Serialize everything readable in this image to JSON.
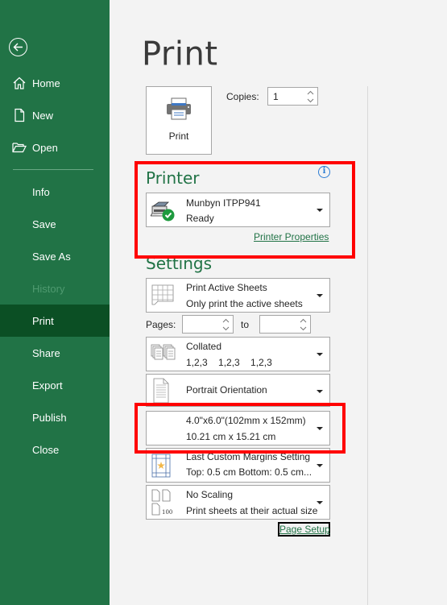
{
  "sidebar": {
    "back_icon": "back-arrow-circle-icon",
    "items": [
      {
        "label": "Home",
        "icon": "home-icon",
        "state": "normal"
      },
      {
        "label": "New",
        "icon": "new-document-icon",
        "state": "normal"
      },
      {
        "label": "Open",
        "icon": "open-folder-icon",
        "state": "normal"
      },
      {
        "label": "Info",
        "state": "normal"
      },
      {
        "label": "Save",
        "state": "normal"
      },
      {
        "label": "Save As",
        "state": "normal"
      },
      {
        "label": "History",
        "state": "disabled"
      },
      {
        "label": "Print",
        "state": "active"
      },
      {
        "label": "Share",
        "state": "normal"
      },
      {
        "label": "Export",
        "state": "normal"
      },
      {
        "label": "Publish",
        "state": "normal"
      },
      {
        "label": "Close",
        "state": "normal"
      }
    ]
  },
  "main": {
    "title": "Print",
    "print_button_label": "Print",
    "copies": {
      "label": "Copies:",
      "value": "1"
    },
    "printer": {
      "section_title": "Printer",
      "info_icon": "i",
      "name": "Munbyn ITPP941",
      "status": "Ready",
      "properties_link": "Printer Properties"
    },
    "settings": {
      "section_title": "Settings",
      "print_what": {
        "line1": "Print Active Sheets",
        "line2": "Only print the active sheets"
      },
      "pages": {
        "label": "Pages:",
        "from": "",
        "to_label": "to",
        "to": ""
      },
      "collation": {
        "line1": "Collated",
        "line2": "1,2,3    1,2,3    1,2,3"
      },
      "orientation": {
        "line1": "Portrait Orientation"
      },
      "paper_size": {
        "line1": "4.0\"x6.0\"(102mm x 152mm)",
        "line2": "10.21 cm x 15.21 cm"
      },
      "margins": {
        "line1": "Last Custom Margins Setting",
        "line2": "Top: 0.5 cm Bottom: 0.5 cm..."
      },
      "scaling": {
        "line1": "No Scaling",
        "line2": "Print sheets at their actual size",
        "icon_text": "100"
      },
      "page_setup_link": "Page Setup"
    }
  },
  "colors": {
    "sidebar_bg": "#217346",
    "sidebar_active": "#0b4f24",
    "accent": "#217346",
    "highlight": "#ff0000",
    "info": "#2b7cd3"
  }
}
